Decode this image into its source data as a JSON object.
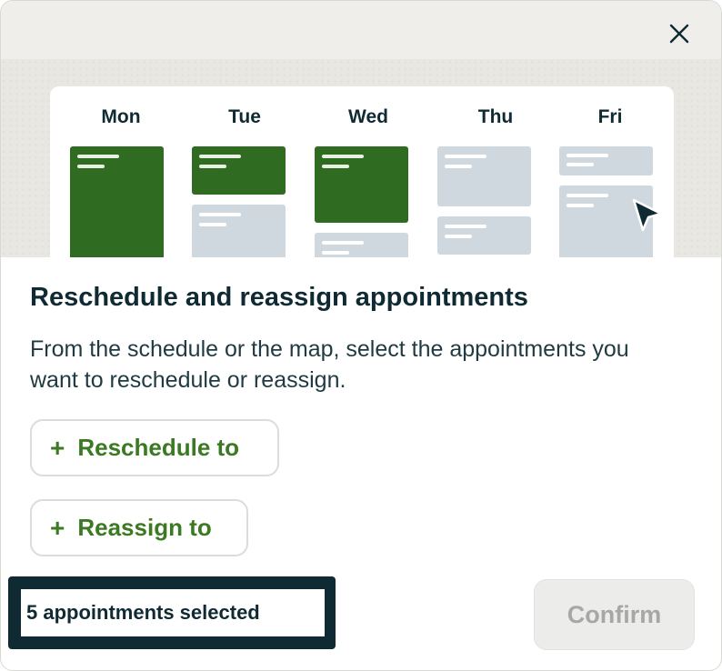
{
  "dialog": {
    "title": "Reschedule and reassign appointments",
    "description": "From the schedule or the map, select the appointments you want to reschedule or reassign.",
    "close_icon": "close-icon"
  },
  "illustration": {
    "days": [
      "Mon",
      "Tue",
      "Wed",
      "Thu",
      "Fri"
    ],
    "colors": {
      "selected": "#2f6b20",
      "unselected": "#cfd8de"
    }
  },
  "actions": {
    "reschedule": {
      "icon": "plus-icon",
      "label": "Reschedule to"
    },
    "reassign": {
      "icon": "plus-icon",
      "label": "Reassign to"
    }
  },
  "footer": {
    "selection_text": "5 appointments selected",
    "confirm_label": "Confirm"
  },
  "colors": {
    "accent_green": "#3b7a22",
    "text_dark": "#0f2a33",
    "disabled_text": "#a7a7a5"
  }
}
